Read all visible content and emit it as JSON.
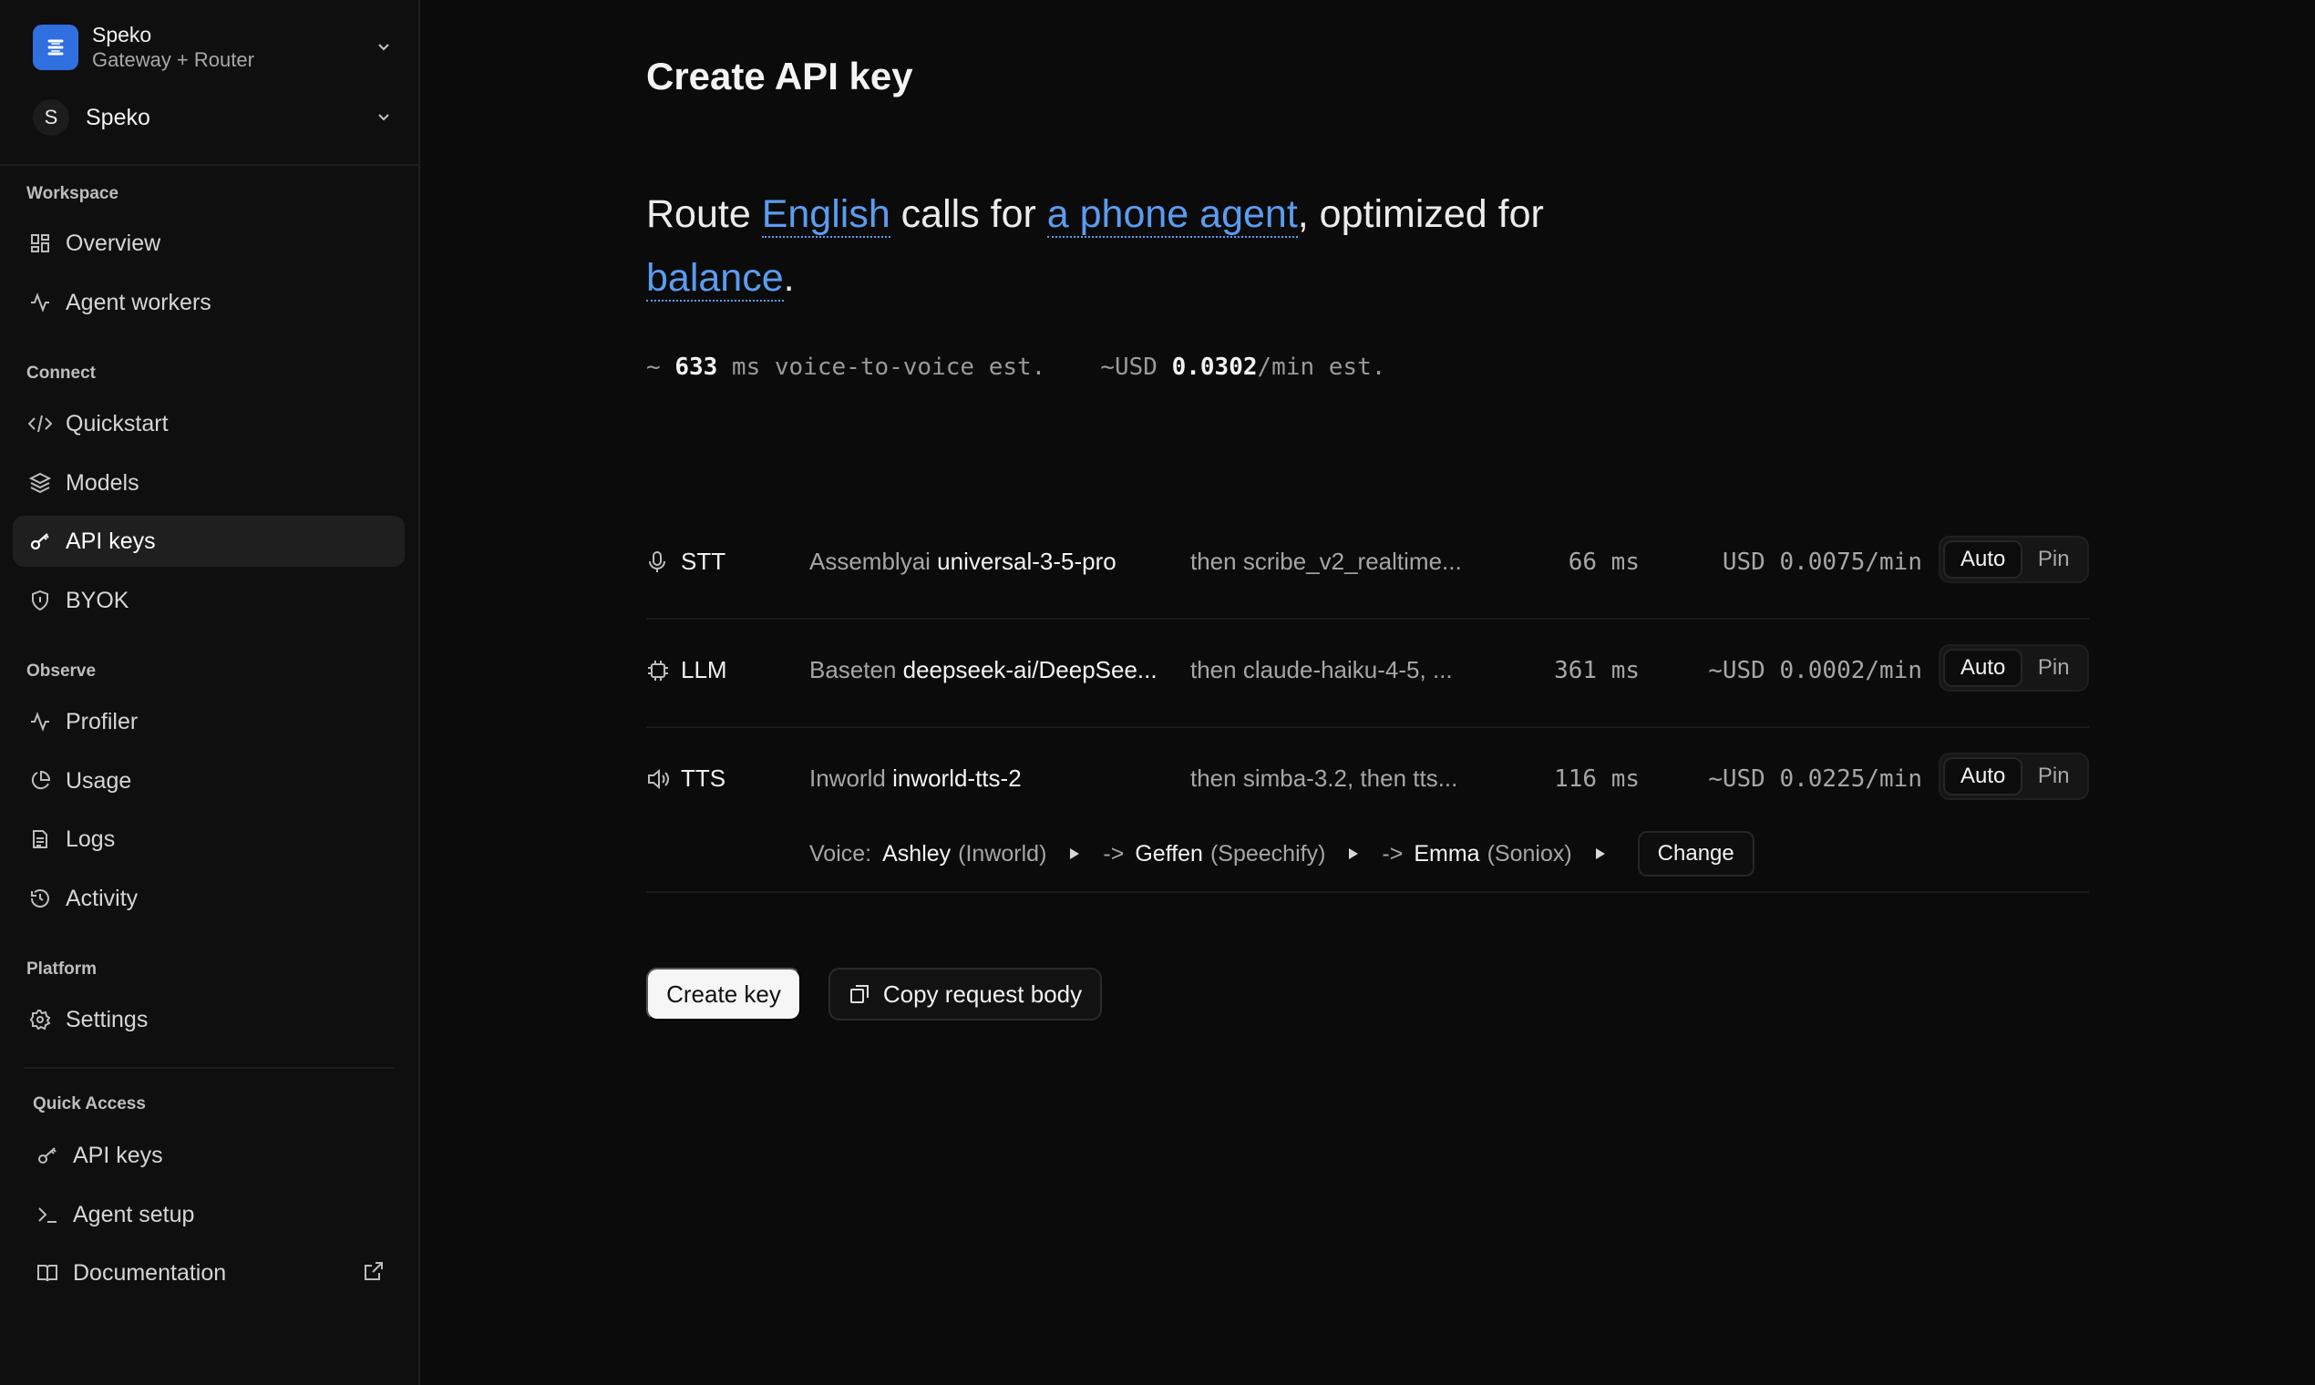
{
  "org": {
    "name": "Speko",
    "subtitle": "Gateway + Router"
  },
  "workspace": {
    "avatar": "S",
    "name": "Speko"
  },
  "sidebar": {
    "sections": [
      {
        "label": "Workspace",
        "items": [
          {
            "label": "Overview",
            "icon": "dashboard-icon"
          },
          {
            "label": "Agent workers",
            "icon": "activity-icon"
          }
        ]
      },
      {
        "label": "Connect",
        "items": [
          {
            "label": "Quickstart",
            "icon": "code-icon"
          },
          {
            "label": "Models",
            "icon": "layers-icon"
          },
          {
            "label": "API keys",
            "icon": "key-icon",
            "active": true
          },
          {
            "label": "BYOK",
            "icon": "shield-icon"
          }
        ]
      },
      {
        "label": "Observe",
        "items": [
          {
            "label": "Profiler",
            "icon": "activity-icon"
          },
          {
            "label": "Usage",
            "icon": "pie-chart-icon"
          },
          {
            "label": "Logs",
            "icon": "log-icon"
          },
          {
            "label": "Activity",
            "icon": "history-icon"
          }
        ]
      },
      {
        "label": "Platform",
        "items": [
          {
            "label": "Settings",
            "icon": "gear-icon"
          }
        ]
      },
      {
        "label": "Quick Access",
        "items": [
          {
            "label": "API keys",
            "icon": "key-icon"
          },
          {
            "label": "Agent setup",
            "icon": "terminal-icon"
          },
          {
            "label": "Documentation",
            "icon": "book-icon",
            "external": true
          }
        ]
      }
    ]
  },
  "page": {
    "title": "Create API key",
    "sentence": {
      "part1": "Route ",
      "language": "English",
      "part2": " calls for ",
      "use_case": "a phone agent",
      "part3": ", optimized for ",
      "priority": "balance",
      "part4": "."
    },
    "estimate": {
      "latency_prefix": "~ ",
      "latency_value": "633",
      "latency_suffix": " ms voice-to-voice est.",
      "cost_prefix": "~USD ",
      "cost_value": "0.0302",
      "cost_suffix": "/min est."
    }
  },
  "routes": [
    {
      "name": "STT",
      "icon": "microphone-icon",
      "provider": "Assemblyai",
      "model": "universal-3-5-pro",
      "fallback": "then scribe_v2_realtime...",
      "latency": "66 ms",
      "cost": "USD 0.0075/min",
      "mode_auto": "Auto",
      "mode_pin": "Pin"
    },
    {
      "name": "LLM",
      "icon": "chip-icon",
      "provider": "Baseten",
      "model": "deepseek-ai/DeepSee...",
      "fallback": "then claude-haiku-4-5, ...",
      "latency": "361 ms",
      "cost": "~USD 0.0002/min",
      "mode_auto": "Auto",
      "mode_pin": "Pin"
    },
    {
      "name": "TTS",
      "icon": "speaker-icon",
      "provider": "Inworld",
      "model": "inworld-tts-2",
      "fallback": "then simba-3.2, then tts...",
      "latency": "116 ms",
      "cost": "~USD 0.0225/min",
      "mode_auto": "Auto",
      "mode_pin": "Pin"
    }
  ],
  "voice": {
    "label": "Voice:",
    "choices": [
      {
        "name": "Ashley",
        "provider": "(Inworld)"
      },
      {
        "name": "Geffen",
        "provider": "(Speechify)"
      },
      {
        "name": "Emma",
        "provider": "(Soniox)"
      }
    ],
    "arrow": "->",
    "change_label": "Change"
  },
  "actions": {
    "create_label": "Create key",
    "copy_label": "Copy request body"
  },
  "colors": {
    "accent": "#5b9cf0",
    "brand": "#2f6fe0",
    "background": "#0b0b0b"
  }
}
